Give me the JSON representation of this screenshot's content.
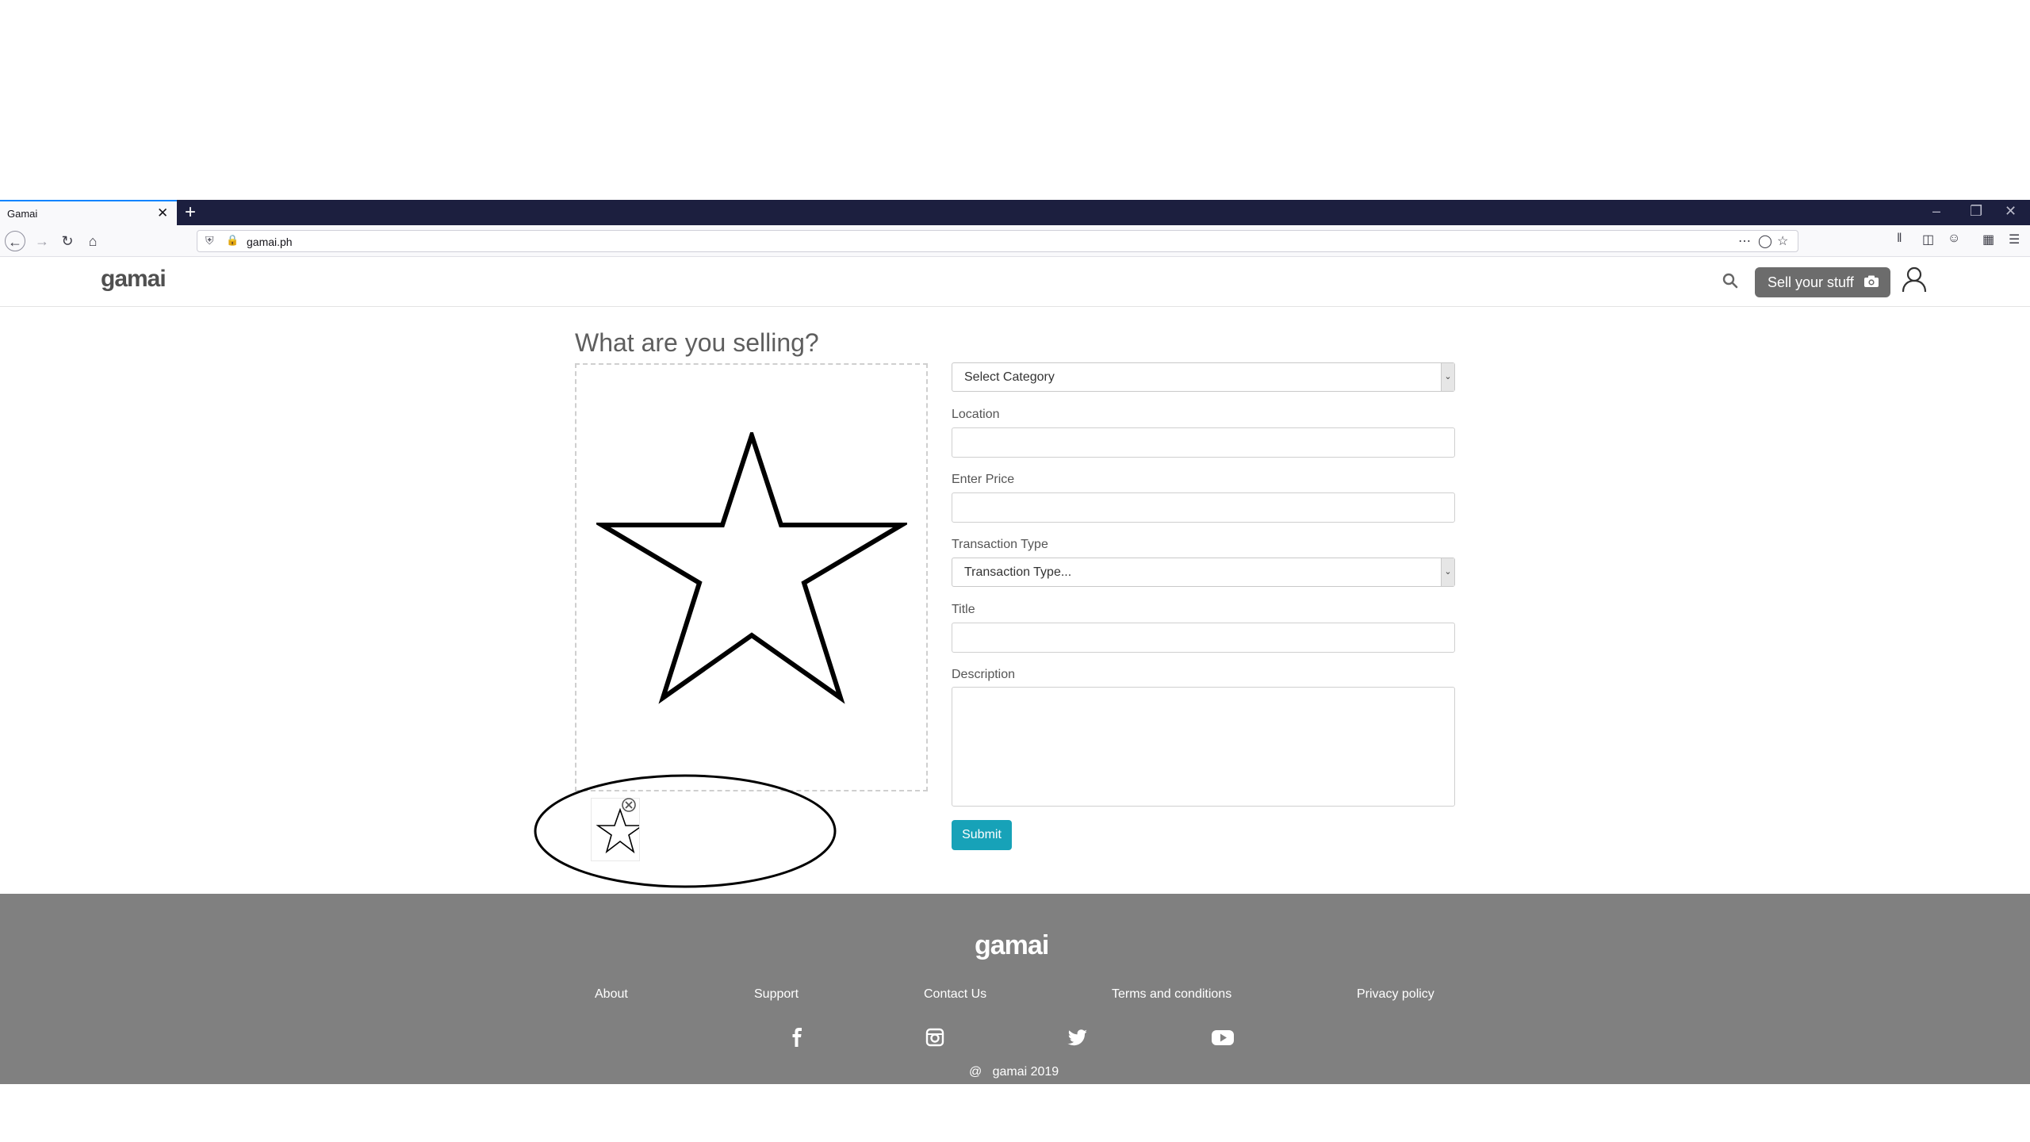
{
  "browser": {
    "tab_title": "Gamai",
    "tab_close": "✕",
    "new_tab": "+",
    "window_controls": [
      "–",
      "❐",
      "✕"
    ],
    "url": "gamai.ph",
    "nav_icons": [
      "back-icon",
      "forward-icon",
      "reload-icon",
      "home-icon"
    ],
    "toolbar_icons": [
      "library-icon",
      "sidebar-icon",
      "account-icon",
      "extensions-icon",
      "menu-icon"
    ]
  },
  "header": {
    "logo": "gamai",
    "sell_button": "Sell your stuff"
  },
  "form": {
    "page_title": "What are you selling?",
    "category_select": "Select Category",
    "location_label": "Location",
    "price_label": "Enter Price",
    "transaction_label": "Transaction Type",
    "transaction_select": "Transaction Type...",
    "title_label": "Title",
    "description_label": "Description",
    "submit": "Submit"
  },
  "footer": {
    "logo": "gamai",
    "links": [
      "About",
      "Support",
      "Contact Us",
      "Terms and conditions",
      "Privacy policy"
    ],
    "social": [
      "facebook-icon",
      "instagram-icon",
      "twitter-icon",
      "youtube-icon"
    ],
    "copyright": "@   gamai 2019"
  }
}
